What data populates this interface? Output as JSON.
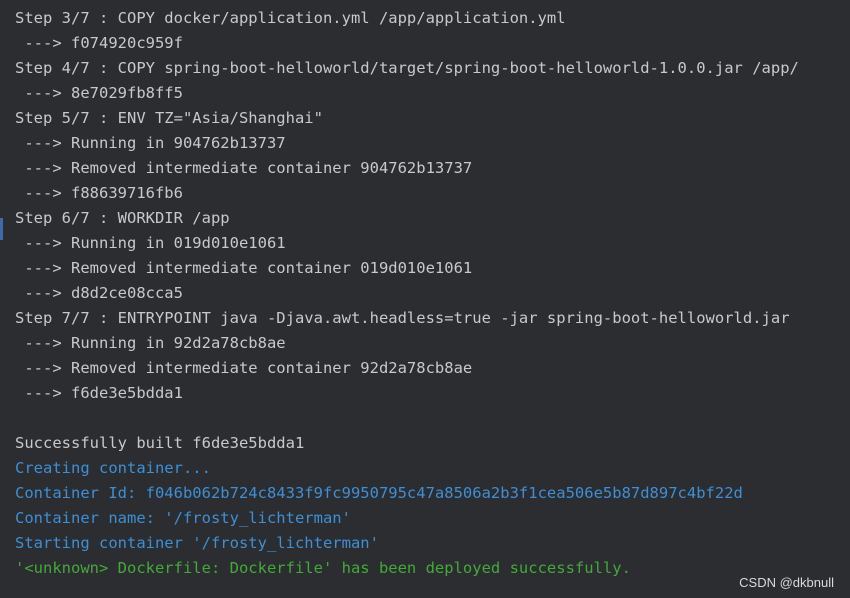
{
  "console": {
    "lines": [
      {
        "text": "Step 3/7 : COPY docker/application.yml /app/application.yml",
        "kind": "normal"
      },
      {
        "text": " ---> f074920c959f",
        "kind": "normal"
      },
      {
        "text": "Step 4/7 : COPY spring-boot-helloworld/target/spring-boot-helloworld-1.0.0.jar /app/",
        "kind": "normal"
      },
      {
        "text": " ---> 8e7029fb8ff5",
        "kind": "normal"
      },
      {
        "text": "Step 5/7 : ENV TZ=\"Asia/Shanghai\"",
        "kind": "normal"
      },
      {
        "text": " ---> Running in 904762b13737",
        "kind": "normal"
      },
      {
        "text": " ---> Removed intermediate container 904762b13737",
        "kind": "normal"
      },
      {
        "text": " ---> f88639716fb6",
        "kind": "normal"
      },
      {
        "text": "Step 6/7 : WORKDIR /app",
        "kind": "normal"
      },
      {
        "text": " ---> Running in 019d010e1061",
        "kind": "normal"
      },
      {
        "text": " ---> Removed intermediate container 019d010e1061",
        "kind": "normal"
      },
      {
        "text": " ---> d8d2ce08cca5",
        "kind": "normal"
      },
      {
        "text": "Step 7/7 : ENTRYPOINT java -Djava.awt.headless=true -jar spring-boot-helloworld.jar",
        "kind": "normal"
      },
      {
        "text": " ---> Running in 92d2a78cb8ae",
        "kind": "normal"
      },
      {
        "text": " ---> Removed intermediate container 92d2a78cb8ae",
        "kind": "normal"
      },
      {
        "text": " ---> f6de3e5bdda1",
        "kind": "normal"
      },
      {
        "text": "",
        "kind": "normal"
      },
      {
        "text": "Successfully built f6de3e5bdda1",
        "kind": "normal"
      },
      {
        "text": "Creating container...",
        "kind": "info"
      },
      {
        "text": "Container Id: f046b062b724c8433f9fc9950795c47a8506a2b3f1cea506e5b87d897c4bf22d",
        "kind": "info"
      },
      {
        "text": "Container name: '/frosty_lichterman'",
        "kind": "info"
      },
      {
        "text": "Starting container '/frosty_lichterman'",
        "kind": "info"
      },
      {
        "text": "'<unknown> Dockerfile: Dockerfile' has been deployed successfully.",
        "kind": "success"
      }
    ]
  },
  "watermark": "CSDN @dkbnull",
  "colors": {
    "background": "#2b2d30",
    "text": "#c7c9cc",
    "info": "#3e8fd6",
    "success": "#44a83a"
  }
}
